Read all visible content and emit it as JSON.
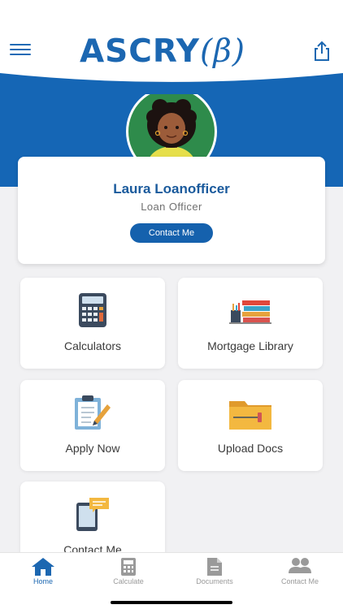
{
  "header": {
    "logo_main": "ASCRY",
    "logo_beta": "(β)",
    "menu_icon": "hamburger-icon",
    "share_icon": "share-icon"
  },
  "colors": {
    "brand_blue": "#1c67b1",
    "button_blue": "#1561ad",
    "background": "#f1f1f3"
  },
  "profile": {
    "name": "Laura Loanofficer",
    "role": "Loan Officer",
    "contact_label": "Contact Me"
  },
  "tiles": [
    {
      "label": "Calculators",
      "icon": "calculator-icon"
    },
    {
      "label": "Mortgage Library",
      "icon": "books-icon"
    },
    {
      "label": "Apply Now",
      "icon": "clipboard-icon"
    },
    {
      "label": "Upload Docs",
      "icon": "folder-icon"
    },
    {
      "label": "Contact Me",
      "icon": "phone-message-icon"
    }
  ],
  "tabbar": [
    {
      "label": "Home",
      "icon": "home-icon",
      "active": true
    },
    {
      "label": "Calculate",
      "icon": "calculator-icon",
      "active": false
    },
    {
      "label": "Documents",
      "icon": "document-icon",
      "active": false
    },
    {
      "label": "Contact Me",
      "icon": "people-icon",
      "active": false
    }
  ]
}
